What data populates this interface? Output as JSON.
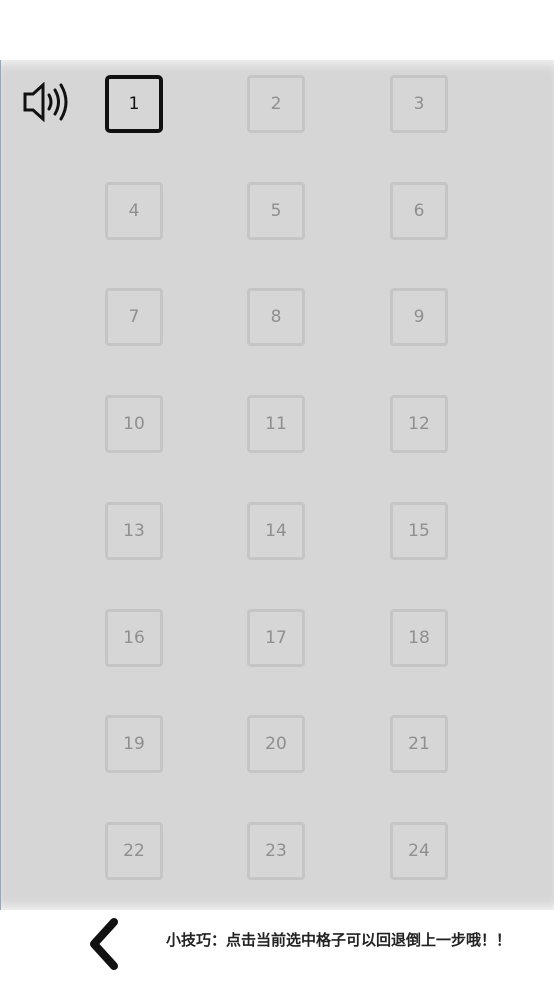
{
  "sound_icon": "speaker-volume-icon",
  "back_icon": "chevron-left-icon",
  "levels": [
    "1",
    "2",
    "3",
    "4",
    "5",
    "6",
    "7",
    "8",
    "9",
    "10",
    "11",
    "12",
    "13",
    "14",
    "15",
    "16",
    "17",
    "18",
    "19",
    "20",
    "21",
    "22",
    "23",
    "24"
  ],
  "selected_level": "1",
  "tip_text": "小技巧：点击当前选中格子可以回退倒上一步哦！！"
}
